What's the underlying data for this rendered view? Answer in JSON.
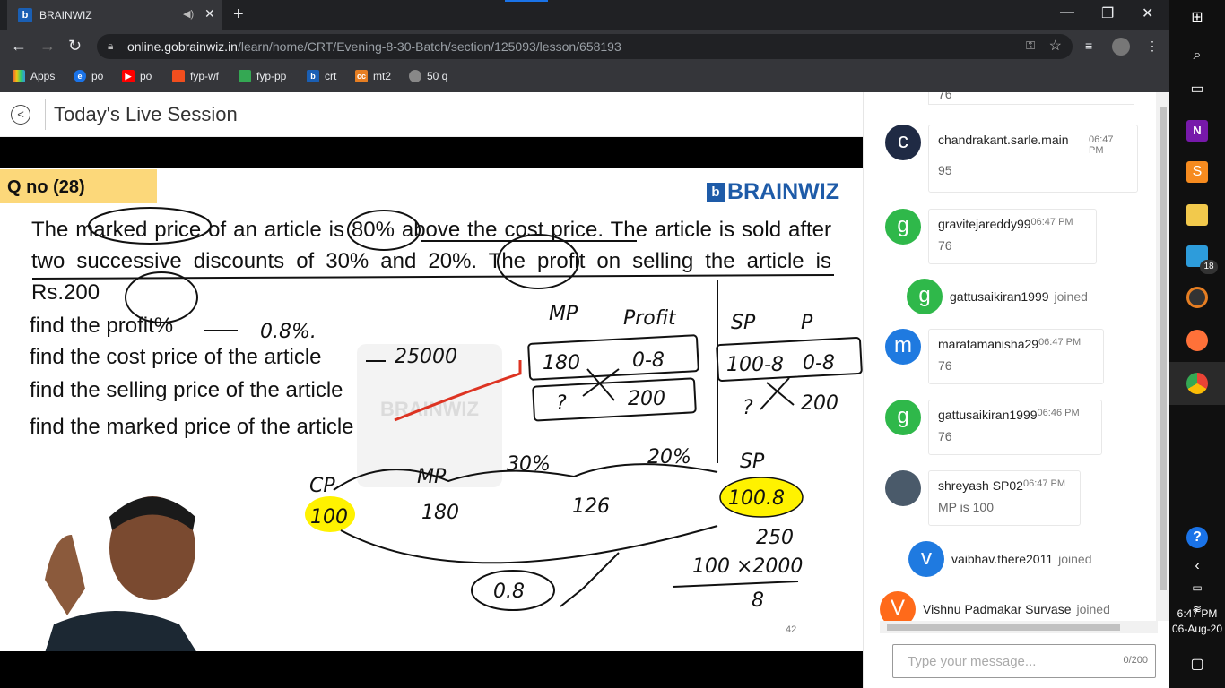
{
  "browser": {
    "tab_title": "BRAINWIZ",
    "tab_favicon": "b",
    "url_host": "online.gobrainwiz.in",
    "url_path": "/learn/home/CRT/Evening-8-30-Batch/section/125093/lesson/658193"
  },
  "bookmarks": [
    {
      "label": "Apps",
      "color": "#e74c3c"
    },
    {
      "label": "po",
      "color": "#1a73e8"
    },
    {
      "label": "po",
      "color": "#ff0000"
    },
    {
      "label": "fyp-wf",
      "color": "#f24e1e"
    },
    {
      "label": "fyp-pp",
      "color": "#34a853"
    },
    {
      "label": "crt",
      "color": "#1a5fb4"
    },
    {
      "label": "mt2",
      "color": "#e67e22"
    },
    {
      "label": "50 q",
      "color": "#888888"
    }
  ],
  "page": {
    "title": "Today's Live Session"
  },
  "slide": {
    "qno": "Q no (28)",
    "logo": "BRAINWIZ",
    "question": "The marked price of an article is 80% above the cost price. The article is sold after two successive discounts of 30% and 20%. The profit on selling the article is Rs.200",
    "tasks": [
      "find the profit%",
      "find the cost price of the article",
      "find the selling price of the article",
      "find the marked price of the article"
    ],
    "page_number": "42",
    "watermark": "BRAINWIZ",
    "handwriting": {
      "profit": "0.8%.",
      "cp": "25000",
      "mp_h": "MP",
      "pr_h": "Profit",
      "sp_h": "SP",
      "p_h": "P",
      "v180": "180",
      "v08a": "0-8",
      "q1": "?",
      "v200a": "200",
      "v1008a": "100-8",
      "v08b": "0-8",
      "q2": "?",
      "v200b": "200",
      "cp_l": "CP",
      "mp_l": "MP",
      "pct30": "30%",
      "pct20": "20%",
      "sp_l": "SP",
      "v100": "100",
      "v180b": "180",
      "v126": "126",
      "v1008b": "100.8",
      "v250": "250",
      "calc": "100 ×2000",
      "v8": "8",
      "v08c": "0.8"
    }
  },
  "chat": {
    "messages": [
      {
        "kind": "msg",
        "initial": "c",
        "color": "#1f2a44",
        "name": "chandrakant.sarle.main",
        "time": "06:47 PM",
        "text": "95"
      },
      {
        "kind": "msg",
        "initial": "g",
        "color": "#2fb84a",
        "name": "gravitejareddy99",
        "time": "06:47 PM",
        "text": "76"
      },
      {
        "kind": "join",
        "initial": "g",
        "color": "#2fb84a",
        "name": "gattusaikiran1999",
        "text": "joined"
      },
      {
        "kind": "msg",
        "initial": "m",
        "color": "#1f7ae0",
        "name": "maratamanisha29",
        "time": "06:47 PM",
        "text": "76"
      },
      {
        "kind": "msg",
        "initial": "g",
        "color": "#2fb84a",
        "name": "gattusaikiran1999",
        "time": "06:46 PM",
        "text": "76"
      },
      {
        "kind": "msg",
        "initial": "",
        "color": "#4a5a6a",
        "name": "shreyash SP02",
        "time": "06:47 PM",
        "text": "MP is 100"
      },
      {
        "kind": "join",
        "initial": "v",
        "color": "#1f7ae0",
        "name": "vaibhav.there2011",
        "text": "joined"
      },
      {
        "kind": "join",
        "initial": "V",
        "color": "#ff6a1a",
        "name": "Vishnu Padmakar Survase",
        "text": "joined"
      }
    ],
    "partial_top_text": "76",
    "input_placeholder": "Type your message...",
    "input_counter": "0/200"
  },
  "taskbar": {
    "time": "6:47 PM",
    "date": "06-Aug-20",
    "badge": "18"
  }
}
